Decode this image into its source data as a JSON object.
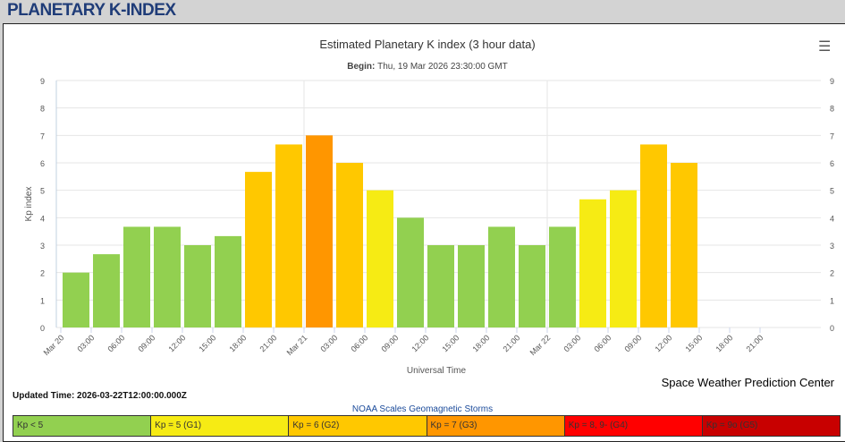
{
  "header": {
    "title": "PLANETARY K-INDEX"
  },
  "updated": "Updated Time: 2026-03-22T12:00:00.000Z",
  "credit": "Space Weather Prediction Center",
  "menu_icon": "hamburger-menu-icon",
  "scale": {
    "title": "NOAA Scales Geomagnetic Storms",
    "items": [
      {
        "label": "Kp < 5",
        "color": "#92d050"
      },
      {
        "label": "Kp = 5 (G1)",
        "color": "#f6eb14"
      },
      {
        "label": "Kp = 6 (G2)",
        "color": "#ffc800"
      },
      {
        "label": "Kp = 7 (G3)",
        "color": "#ff9600"
      },
      {
        "label": "Kp = 8, 9- (G4)",
        "color": "#ff0000"
      },
      {
        "label": "Kp = 9o (G5)",
        "color": "#c80000"
      }
    ]
  },
  "chart_data": {
    "type": "bar",
    "title": "Estimated Planetary K index (3 hour data)",
    "subtitle_label": "Begin:",
    "subtitle": "Thu, 19 Mar 2026 23:30:00 GMT",
    "xlabel": "Universal Time",
    "ylabel": "Kp index",
    "ylim": [
      0,
      9
    ],
    "yticks": [
      0,
      1,
      2,
      3,
      4,
      5,
      6,
      7,
      8,
      9
    ],
    "categories": [
      "Mar 20",
      "03:00",
      "06:00",
      "09:00",
      "12:00",
      "15:00",
      "18:00",
      "21:00",
      "Mar 21",
      "03:00",
      "06:00",
      "09:00",
      "12:00",
      "15:00",
      "18:00",
      "21:00",
      "Mar 22",
      "03:00",
      "06:00",
      "09:00",
      "12:00",
      "15:00",
      "18:00",
      "21:00"
    ],
    "values": [
      2.0,
      2.67,
      3.67,
      3.67,
      3.0,
      3.33,
      5.67,
      6.67,
      7.0,
      6.0,
      5.0,
      4.0,
      3.0,
      3.0,
      3.67,
      3.0,
      3.67,
      4.67,
      5.0,
      6.67,
      6.0
    ],
    "grid": true
  }
}
